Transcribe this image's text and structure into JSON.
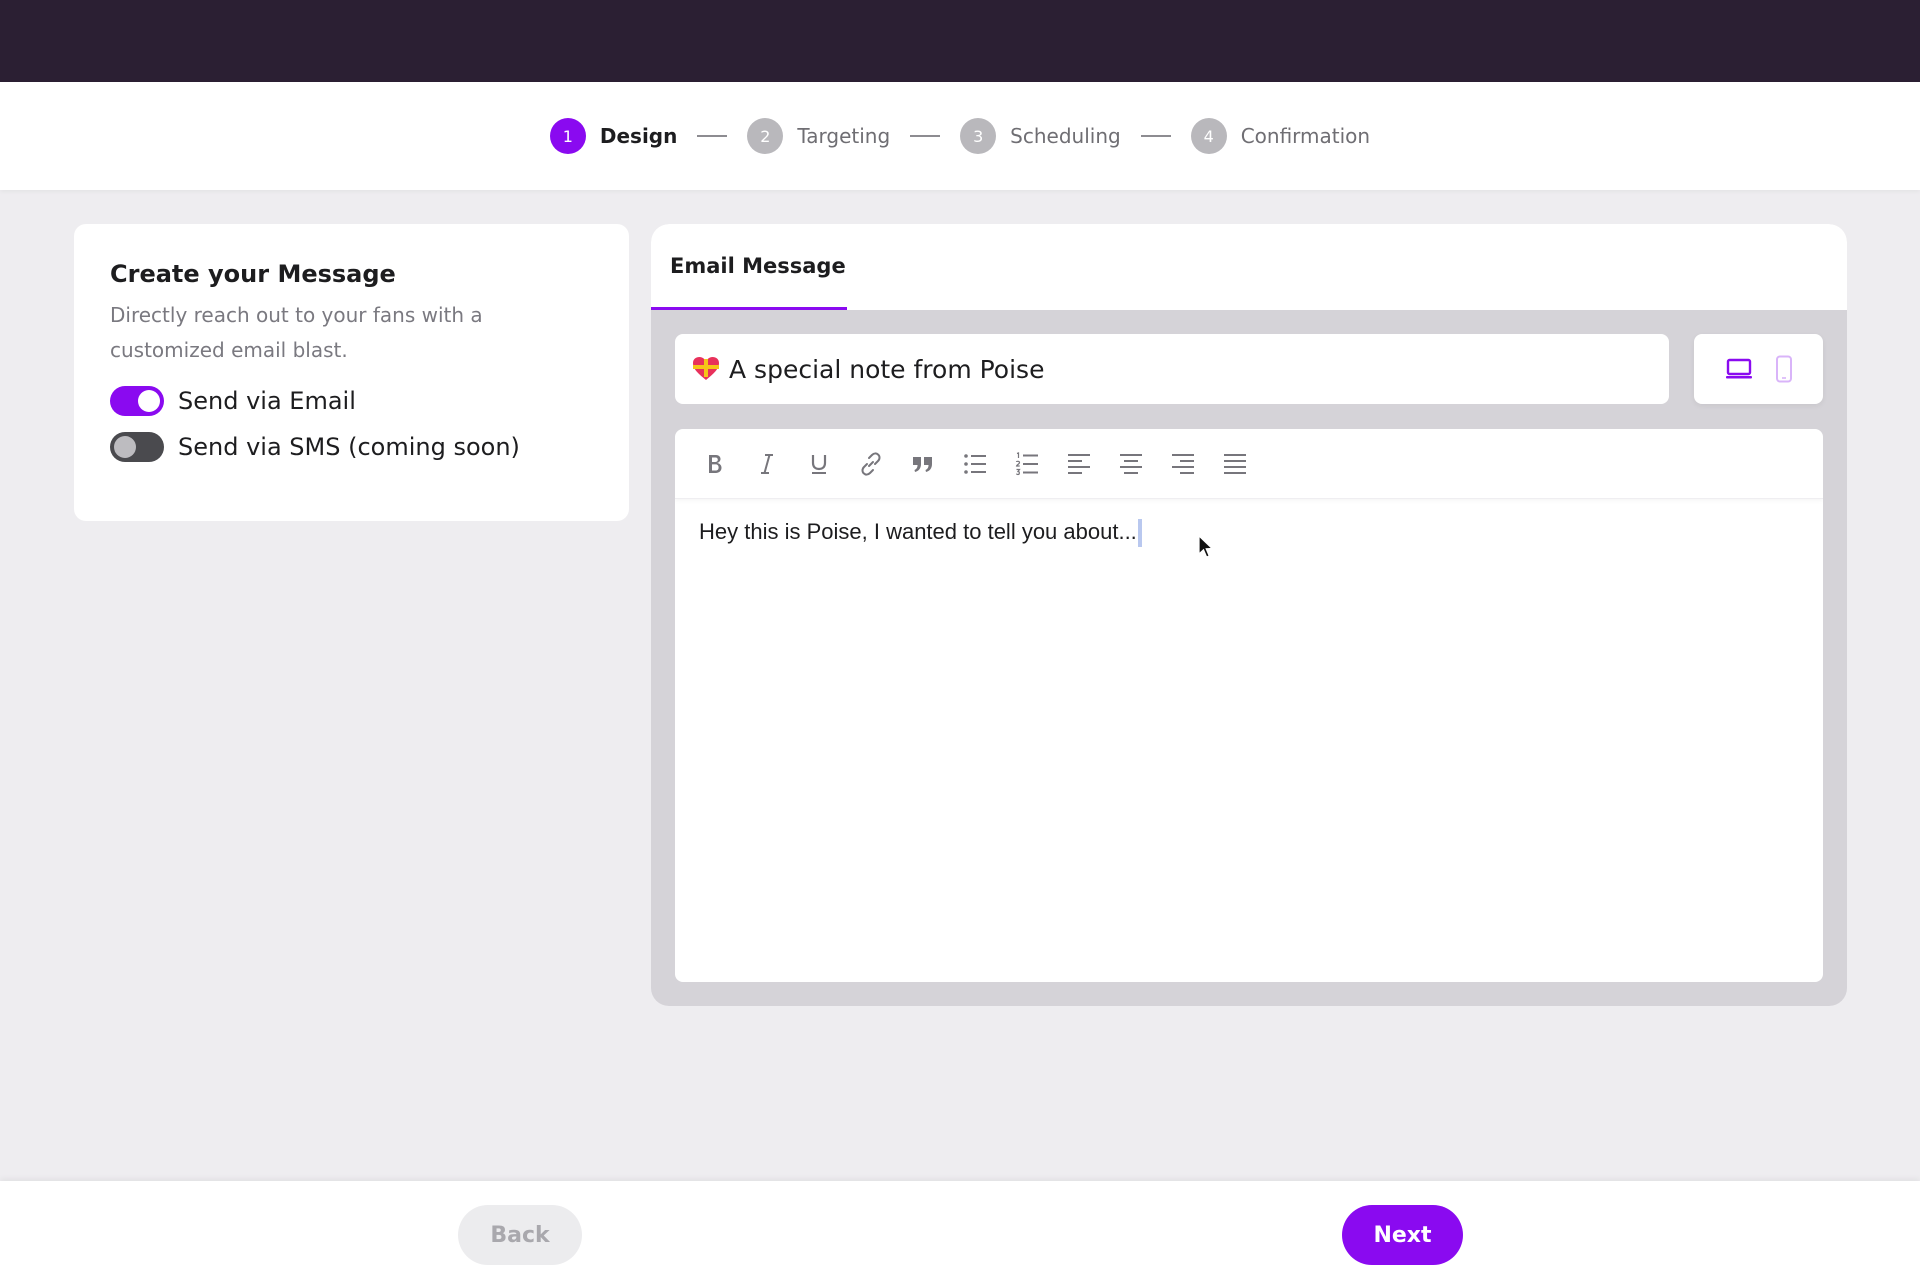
{
  "stepper": {
    "steps": [
      {
        "number": "1",
        "label": "Design",
        "active": true
      },
      {
        "number": "2",
        "label": "Targeting",
        "active": false
      },
      {
        "number": "3",
        "label": "Scheduling",
        "active": false
      },
      {
        "number": "4",
        "label": "Confirmation",
        "active": false
      }
    ]
  },
  "left_panel": {
    "title": "Create your Message",
    "description": "Directly reach out to your fans with a customized email blast.",
    "toggles": [
      {
        "label": "Send via Email",
        "on": true
      },
      {
        "label": "Send via SMS (coming soon)",
        "on": false
      }
    ]
  },
  "message": {
    "tab_label": "Email Message",
    "subject_emoji_icon": "heart-with-ribbon-icon",
    "subject": "A special note from Poise",
    "devices": [
      "desktop-icon",
      "mobile-icon"
    ],
    "toolbar": [
      "bold-icon",
      "italic-icon",
      "underline-icon",
      "link-icon",
      "quote-icon",
      "bullet-list-icon",
      "numbered-list-icon",
      "align-left-icon",
      "align-center-icon",
      "align-right-icon",
      "align-justify-icon"
    ],
    "body": "Hey this is Poise, I wanted to tell you about..."
  },
  "footer": {
    "back_label": "Back",
    "next_label": "Next"
  },
  "colors": {
    "accent": "#8a0af0",
    "topbar": "#2b1f33"
  }
}
